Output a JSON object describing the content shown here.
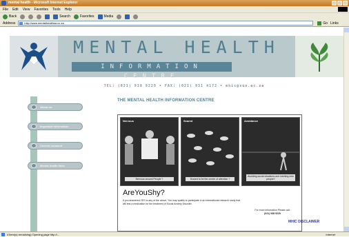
{
  "browser": {
    "title": "mental health - Microsoft Internet Explorer",
    "menu": [
      "File",
      "Edit",
      "View",
      "Favorites",
      "Tools",
      "Help"
    ],
    "toolbar": [
      "Back",
      "Search",
      "Favorites",
      "Media"
    ],
    "address_label": "Address",
    "url": "http://www.mentalhealthsa.co.za",
    "go_label": "Go",
    "links_label": "Links",
    "status_text": "4 item(s) remaining) Opening page http://...",
    "zone": "Internet"
  },
  "site": {
    "title": "MENTAL HEALTH",
    "subtitle": "INFORMATION CENTRE",
    "contact": "TEL: (021) 938 9229 • FAX: (021) 931 4172 • mhic@sun.ac.za",
    "heading": "THE MENTAL HEALTH INFORMATION CENTRE",
    "nav": [
      {
        "label": "About us"
      },
      {
        "label": "Important information"
      },
      {
        "label": "Current research"
      },
      {
        "label": "Mental health links"
      }
    ],
    "poster": {
      "panels": [
        {
          "label": "Nervous",
          "caption": "Nervous around People ?"
        },
        {
          "label": "Scared",
          "caption": "Scared to be the centre of attention ?"
        },
        {
          "label": "Avoidance",
          "caption": "Avoiding social situations and meeting new people?"
        }
      ],
      "title_are": "Are",
      "title_you": "You",
      "title_shy": "Shy?",
      "body": "If you answered YES to any of the above, You may qualify to participate in an international research study that will test a medication for the treatment of Social Anxiety Disorder.",
      "more_info": "For more information Please call:",
      "phone": "(021) 938 9229"
    },
    "disclaimer": "MHIC DISCLAIMER"
  }
}
